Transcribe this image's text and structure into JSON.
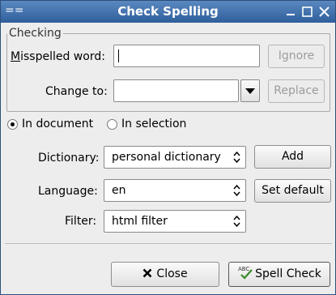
{
  "window": {
    "title": "Check Spelling"
  },
  "checking": {
    "legend": "Checking",
    "misspelled_label": "Misspelled word:",
    "misspelled_value": "",
    "change_to_label": "Change to:",
    "change_to_value": "",
    "ignore_label": "Ignore",
    "replace_label": "Replace"
  },
  "scope": {
    "in_document_label": "In document",
    "in_selection_label": "In selection",
    "selected": "in_document"
  },
  "options": {
    "dictionary_label": "Dictionary:",
    "dictionary_value": "personal dictionary",
    "language_label": "Language:",
    "language_value": "en",
    "filter_label": "Filter:",
    "filter_value": "html filter",
    "add_label": "Add",
    "set_default_label": "Set default"
  },
  "footer": {
    "close_label": "Close",
    "spell_check_label": "Spell Check"
  },
  "icons": {
    "window_menu": "window-menu-icon",
    "minimize": "minimize-icon",
    "maximize": "maximize-icon",
    "close_window": "close-window-icon",
    "close_button": "close-x-icon",
    "spell_check": "spell-check-icon"
  }
}
